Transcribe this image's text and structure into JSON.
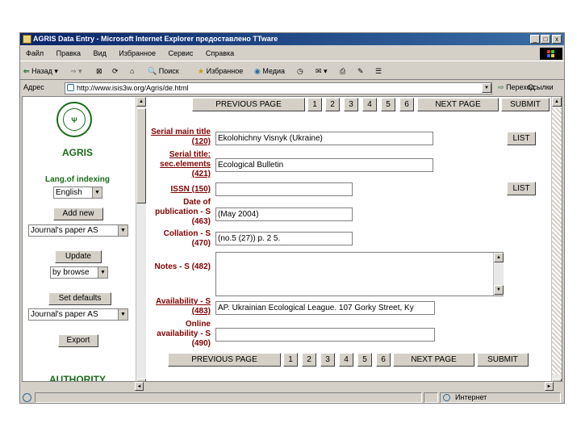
{
  "window": {
    "title": "AGRIS Data Entry - Microsoft Internet Explorer предоставлено TTware",
    "controls": [
      "_",
      "□",
      "x"
    ]
  },
  "menu": [
    "Файл",
    "Правка",
    "Вид",
    "Избранное",
    "Сервис",
    "Справка"
  ],
  "toolbar": {
    "back": "Назад",
    "search": "Поиск",
    "favorites": "Избранное",
    "media": "Медиа"
  },
  "address": {
    "label": "Адрес",
    "url": "http://www.isis3w.org/Agris/de.html",
    "go": "Переход",
    "links": "Ссылки"
  },
  "left_panel": {
    "title": "AGRIS",
    "lang_label": "Lang.of indexing",
    "lang_value": "English",
    "add_new": "Add new",
    "type_value": "Journal's paper AS",
    "update": "Update",
    "browse_value": "by browse",
    "set_defaults": "Set defaults",
    "defaults_value": "Journal's paper AS",
    "export": "Export",
    "authority": "AUTHORITY"
  },
  "pager": {
    "previous": "PREVIOUS PAGE",
    "pages": [
      "1",
      "2",
      "3",
      "4",
      "5",
      "6"
    ],
    "next": "NEXT PAGE",
    "submit": "SUBMIT"
  },
  "form": {
    "list_label": "LIST",
    "fields": [
      {
        "label": "Serial main title (120)",
        "value": "Ekolohichny Visnyk (Ukraine)"
      },
      {
        "label": "Serial title: sec.elements (421)",
        "value": "Ecological Bulletin"
      },
      {
        "label": "ISSN (150)",
        "value": ""
      },
      {
        "label": "Date of publication - S (463)",
        "value": "(May 2004)"
      },
      {
        "label": "Collation - S (470)",
        "value": "(no.5 (27)) p. 2 5."
      },
      {
        "label": "Notes - S (482)",
        "value": ""
      },
      {
        "label": "Availability - S (483)",
        "value": "AP. Ukrainian Ecological League. 107 Gorky Street, Ky"
      },
      {
        "label": "Online availability - S (490)",
        "value": ""
      }
    ]
  },
  "status": {
    "zone": "Интернет"
  }
}
